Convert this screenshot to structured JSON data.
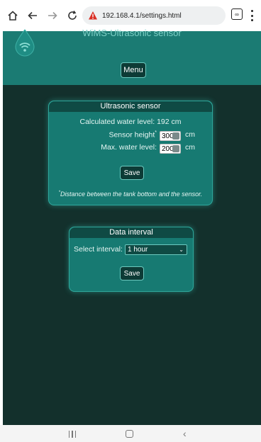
{
  "browser": {
    "url": "192.168.4.1/settings.html",
    "tab_count": "∞"
  },
  "header": {
    "title": "WiMS-Ultrasonic sensor",
    "menu_label": "Menu"
  },
  "ultrasonic_panel": {
    "title": "Ultrasonic sensor",
    "calculated_label": "Calculated water level:",
    "calculated_value": "192 cm",
    "sensor_height_label": "Sensor height",
    "sensor_height_mark": "*",
    "sensor_height_value": "300",
    "sensor_height_unit": "cm",
    "max_level_label": "Max. water level:",
    "max_level_value": "200",
    "max_level_unit": "cm",
    "save_label": "Save",
    "footnote_mark": "*",
    "footnote": "Distance between the tank bottom and the sensor."
  },
  "interval_panel": {
    "title": "Data interval",
    "select_label": "Select interval:",
    "selected_value": "1 hour",
    "save_label": "Save"
  },
  "colors": {
    "header_bg": "#1b7b73",
    "page_bg": "#13302c",
    "panel_bg": "#177a72",
    "button_bg": "#0d3b36"
  }
}
